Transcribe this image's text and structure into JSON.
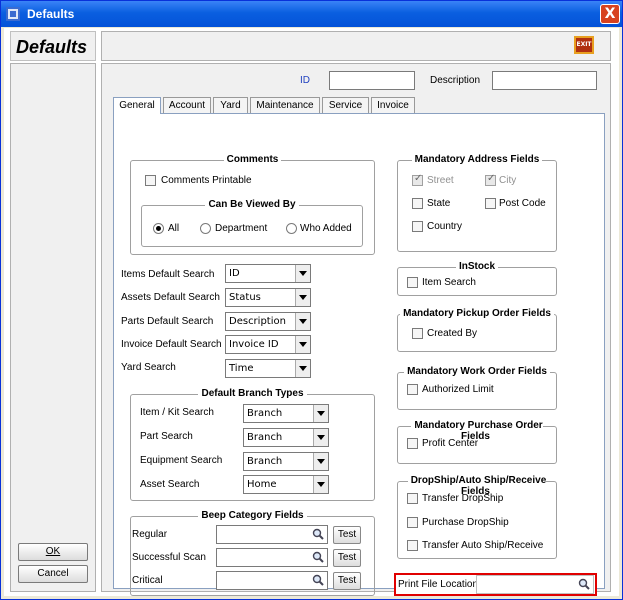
{
  "window": {
    "title": "Defaults",
    "close": "X"
  },
  "header": {
    "title": "Defaults",
    "exit": "EXIT"
  },
  "buttons": {
    "ok": "OK",
    "cancel": "Cancel"
  },
  "top": {
    "id_label": "ID",
    "id_value": "",
    "description_label": "Description",
    "description_value": ""
  },
  "tabs": [
    {
      "label": "General"
    },
    {
      "label": "Account"
    },
    {
      "label": "Yard"
    },
    {
      "label": "Maintenance"
    },
    {
      "label": "Service"
    },
    {
      "label": "Invoice"
    }
  ],
  "comments": {
    "title": "Comments",
    "printable": "Comments Printable",
    "viewed_by": {
      "title": "Can Be Viewed By",
      "options": [
        "All",
        "Department",
        "Who Added"
      ],
      "selected": "All"
    }
  },
  "searches": [
    {
      "label": "Items Default Search",
      "value": "ID"
    },
    {
      "label": "Assets Default Search",
      "value": "Status"
    },
    {
      "label": "Parts Default Search",
      "value": "Description"
    },
    {
      "label": "Invoice Default Search",
      "value": "Invoice ID"
    },
    {
      "label": "Yard Search",
      "value": "Time"
    }
  ],
  "branch": {
    "title": "Default Branch Types",
    "rows": [
      {
        "label": "Item / Kit Search",
        "value": "Branch"
      },
      {
        "label": "Part Search",
        "value": "Branch"
      },
      {
        "label": "Equipment Search",
        "value": "Branch"
      },
      {
        "label": "Asset Search",
        "value": "Home"
      }
    ]
  },
  "beep": {
    "title": "Beep Category Fields",
    "rows": [
      {
        "label": "Regular",
        "value": ""
      },
      {
        "label": "Successful Scan",
        "value": ""
      },
      {
        "label": "Critical",
        "value": ""
      }
    ],
    "test": "Test"
  },
  "address": {
    "title": "Mandatory Address Fields",
    "items": [
      {
        "label": "Street",
        "checked": true,
        "disabled": true
      },
      {
        "label": "City",
        "checked": true,
        "disabled": true
      },
      {
        "label": "State",
        "checked": false,
        "disabled": false
      },
      {
        "label": "Post Code",
        "checked": false,
        "disabled": false
      },
      {
        "label": "Country",
        "checked": false,
        "disabled": false
      }
    ]
  },
  "instock": {
    "title": "InStock",
    "items": [
      {
        "label": "Item Search",
        "checked": false
      }
    ]
  },
  "pickup": {
    "title": "Mandatory Pickup Order Fields",
    "items": [
      {
        "label": "Created By",
        "checked": false
      }
    ]
  },
  "work": {
    "title": "Mandatory Work Order Fields",
    "items": [
      {
        "label": "Authorized Limit",
        "checked": false
      }
    ]
  },
  "purchase": {
    "title": "Mandatory Purchase Order Fields",
    "items": [
      {
        "label": "Profit Center",
        "checked": false
      }
    ]
  },
  "dropship": {
    "title": "DropShip/Auto Ship/Receive Fields",
    "items": [
      {
        "label": "Transfer DropShip",
        "checked": false
      },
      {
        "label": "Purchase DropShip",
        "checked": false
      },
      {
        "label": "Transfer Auto Ship/Receive",
        "checked": false
      }
    ]
  },
  "print_file": {
    "label": "Print File Location",
    "value": ""
  },
  "colors": {
    "title_bar": "#0a5fe0",
    "highlight": "#e00000",
    "label_blue": "#2040c0"
  }
}
